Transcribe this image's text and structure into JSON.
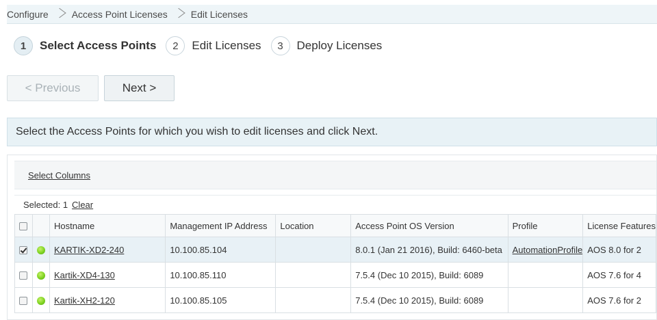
{
  "breadcrumb": [
    "Configure",
    "Access Point Licenses",
    "Edit Licenses"
  ],
  "steps": [
    {
      "num": "1",
      "label": "Select Access Points"
    },
    {
      "num": "2",
      "label": "Edit Licenses"
    },
    {
      "num": "3",
      "label": "Deploy Licenses"
    }
  ],
  "buttons": {
    "previous": "< Previous",
    "next": "Next >"
  },
  "instruction": "Select the Access Points for which you wish to edit licenses and click Next.",
  "toolbar": {
    "select_columns": "Select Columns"
  },
  "selection": {
    "text": "Selected: 1",
    "clear": "Clear"
  },
  "columns": [
    "Hostname",
    "Management IP Address",
    "Location",
    "Access Point OS Version",
    "Profile",
    "License Features"
  ],
  "rows": [
    {
      "checked": true,
      "status_color": "#7fd321",
      "hostname": "KARTIK-XD2-240",
      "ip": "10.100.85.104",
      "location": "",
      "os_version": "8.0.1 (Jan 21 2016), Build: 6460-beta",
      "profile": "AutomationProfile",
      "license": "AOS 8.0 for 2"
    },
    {
      "checked": false,
      "status_color": "#7fd321",
      "hostname": "Kartik-XD4-130",
      "ip": "10.100.85.110",
      "location": "",
      "os_version": "7.5.4 (Dec 10 2015), Build: 6089",
      "profile": "",
      "license": "AOS 7.6 for 4"
    },
    {
      "checked": false,
      "status_color": "#7fd321",
      "hostname": "Kartik-XH2-120",
      "ip": "10.100.85.105",
      "location": "",
      "os_version": "7.5.4 (Dec 10 2015), Build: 6089",
      "profile": "",
      "license": "AOS 7.6 for 2"
    }
  ],
  "icons": {
    "separator": "chevron-right-icon",
    "status": "status-online-icon"
  }
}
